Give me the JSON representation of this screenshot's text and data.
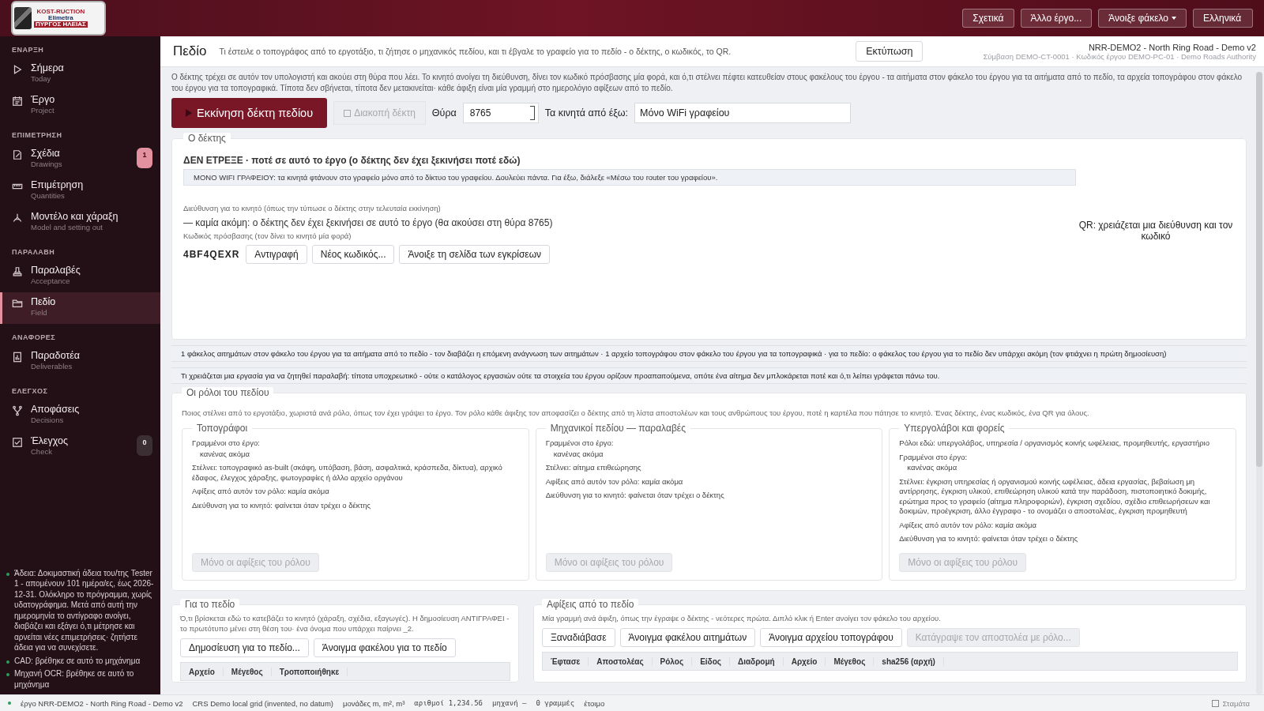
{
  "logo": {
    "lines": [
      "KOST-RUCTION",
      "Elimetra",
      "ΠΥΡΓΟΣ ΗΛΕΙΑΣ"
    ]
  },
  "header_buttons": [
    {
      "label": "Σχετικά",
      "has_menu": false
    },
    {
      "label": "Άλλο έργο...",
      "has_menu": false
    },
    {
      "label": "Άνοιξε φάκελο",
      "has_menu": true
    },
    {
      "label": "Ελληνικά",
      "has_menu": false
    }
  ],
  "sidebar": {
    "sections": [
      {
        "title": "ΕΝΑΡΞΗ",
        "items": [
          {
            "label": "Σήμερα",
            "sublabel": "Today",
            "selected": false
          },
          {
            "label": "Έργο",
            "sublabel": "Project",
            "selected": false
          }
        ]
      },
      {
        "title": "ΕΠΙΜΕΤΡΗΣΗ",
        "items": [
          {
            "label": "Σχέδια",
            "sublabel": "Drawings",
            "selected": false,
            "badge": "1",
            "color": "#e3909f"
          },
          {
            "label": "Επιμέτρηση",
            "sublabel": "Quantities",
            "selected": false
          },
          {
            "label": "Μοντέλο και χάραξη",
            "sublabel": "Model and setting out",
            "selected": false
          }
        ]
      },
      {
        "title": "ΠΑΡΑΛΑΒΗ",
        "items": [
          {
            "label": "Παραλαβές",
            "sublabel": "Acceptance",
            "selected": false
          },
          {
            "label": "Πεδίο",
            "sublabel": "Field",
            "selected": true
          }
        ]
      },
      {
        "title": "ΑΝΑΦΟΡΕΣ",
        "items": [
          {
            "label": "Παραδοτέα",
            "sublabel": "Deliverables",
            "selected": false
          }
        ]
      },
      {
        "title": "ΕΛΕΓΧΟΣ",
        "items": [
          {
            "label": "Αποφάσεις",
            "sublabel": "Decisions",
            "selected": false
          },
          {
            "label": "Έλεγχος",
            "sublabel": "Check",
            "selected": false,
            "badge": "0",
            "color": "#3b2f34"
          }
        ]
      }
    ],
    "notes": [
      {
        "text": "Άδεια: Δοκιμαστική άδεια του/της Tester 1 - απομένουν 101 ημέρα/ες, έως 2026-12-31. Ολόκληρο το πρόγραμμα, χωρίς υδατογράφημα. Μετά από αυτή την ημερομηνία το αντίγραφο ανοίγει, διαβάζει και εξάγει ό,τι μέτρησε και αρνείται νέες επιμετρήσεις· ζητήστε άδεια για να συνεχίσετε.",
        "color": "#2e9e5b"
      },
      {
        "text": "CAD: βρέθηκε σε αυτό το μηχάνημα",
        "color": "#2e9e5b"
      },
      {
        "text": "Μηχανή OCR: βρέθηκε σε αυτό το μηχάνημα",
        "color": "#2e9e5b"
      }
    ]
  },
  "page_header": {
    "title": "Πεδίο",
    "subtitle": "Τι έστειλε ο τοπογράφος από το εργοτάξιο, τι ζήτησε ο μηχανικός πεδίου, και τι έβγαλε το γραφείο για το πεδίο - ο δέκτης, ο κωδικός, το QR.",
    "print_button": "Εκτύπωση",
    "project": "NRR-DEMO2 - North Ring Road - Demo v2",
    "project_meta": "Σύμβαση DEMO-CT-0001 · Κωδικός έργου DEMO-PC-01 · Demo Roads Authority"
  },
  "intro": "Ο δέκτης τρέχει σε αυτόν τον υπολογιστή και ακούει στη θύρα που λέει. Το κινητό ανοίγει τη διεύθυνση, δίνει τον κωδικό πρόσβασης μία φορά, και ό,τι στέλνει πέφτει κατευθείαν στους φακέλους του έργου - τα αιτήματα στον φάκελο του έργου για τα αιτήματα από το πεδίο, τα αρχεία τοπογράφου στον φάκελο του έργου για τα τοπογραφικά. Τίποτα δεν σβήνεται, τίποτα δεν μετακινείται· κάθε άφιξη είναι μία γραμμή στο ημερολόγιο αφίξεων από το πεδίο.",
  "controls": {
    "start_button": {
      "label": "Εκκίνηση δέκτη πεδίου",
      "disabled": false
    },
    "stop_button": {
      "label": "Διακοπή δέκτη",
      "disabled": true
    },
    "port_label": "Θύρα",
    "port_value": "8765",
    "remote_label": "Τα κινητά από έξω:",
    "remote_value": "Μόνο WiFi γραφείου"
  },
  "receiver": {
    "legend": "Ο δέκτης",
    "status": "ΔΕΝ ΕΤΡΕΞΕ · ποτέ σε αυτό το έργο (ο δέκτης δεν έχει ξεκινήσει ποτέ εδώ)",
    "banner": "ΜΟΝΟ WIFI ΓΡΑΦΕΙΟΥ: τα κινητά φτάνουν στο γραφείο μόνο από το δίκτυο του γραφείου. Δουλεύει πάντα. Για έξω, διάλεξε «Μέσω του router του γραφείου».",
    "address_label": "Διεύθυνση για το κινητό (όπως την τύπωσε ο δέκτης στην τελευταία εκκίνηση)",
    "address": "— καμία ακόμη: ο δέκτης δεν έχει ξεκινήσει σε αυτό το έργο (θα ακούσει στη θύρα 8765)",
    "code_label": "Κωδικός πρόσβασης (τον δίνει το κινητό μία φορά)",
    "code": "4BF4QEXR",
    "buttons": [
      "Αντιγραφή",
      "Νέος κωδικός...",
      "Άνοιξε τη σελίδα των εγκρίσεων"
    ],
    "qr_note": "QR: χρειάζεται μια διεύθυνση και τον κωδικό"
  },
  "info_lines": [
    "1 φάκελος αιτημάτων στον φάκελο του έργου για τα αιτήματα από το πεδίο - τον διαβάζει η επόμενη ανάγνωση των αιτημάτων  ·  1 αρχείο τοπογράφου στον φάκελο του έργου για τα τοπογραφικά  ·  για το πεδίο: ο φάκελος του έργου για το πεδίο δεν υπάρχει ακόμη (τον φτιάχνει η πρώτη δημοσίευση)",
    "Τι χρειάζεται μια εργασία για να ζητηθεί παραλαβή: τίποτα υποχρεωτικό - ούτε ο κατάλογος εργασιών ούτε τα στοιχεία του έργου ορίζουν προαπαιτούμενα, οπότε ένα αίτημα δεν μπλοκάρεται ποτέ και ό,τι λείπει γράφεται πάνω του."
  ],
  "roles": {
    "legend": "Οι ρόλοι του πεδίου",
    "intro": "Ποιος στέλνει από το εργοτάξιο, χωριστά ανά ρόλο, όπως τον έχει γράψει το έργο. Τον ρόλο κάθε άφιξης τον αποφασίζει ο δέκτης από τη λίστα αποστολέων και τους ανθρώπους του έργου, ποτέ η καρτέλα που πάτησε το κινητό. Ένας δέκτης, ένας κωδικός, ένα QR για όλους.",
    "items": [
      {
        "title": "Τοπογράφοι",
        "lines": [
          {
            "text": "Γραμμένοι στο έργο:",
            "indented": false
          },
          {
            "text": "κανένας ακόμα",
            "indented": true
          },
          {
            "text": "Στέλνει: τοπογραφικό as-built (σκάφη, υπόβαση, βάση, ασφαλτικά, κράσπεδα, δίκτυα), αρχικό έδαφος, έλεγχος χάραξης, φωτογραφίες ή άλλο αρχείο οργάνου",
            "indented": false
          },
          {
            "text": "Αφίξεις από αυτόν τον ρόλο: καμία ακόμα",
            "indented": false
          },
          {
            "text": "Διεύθυνση για το κινητό: φαίνεται όταν τρέχει ο δέκτης",
            "indented": false
          }
        ],
        "button": {
          "label": "Μόνο οι αφίξεις του ρόλου",
          "disabled": true
        }
      },
      {
        "title": "Μηχανικοί πεδίου — παραλαβές",
        "lines": [
          {
            "text": "Γραμμένοι στο έργο:",
            "indented": false
          },
          {
            "text": "κανένας ακόμα",
            "indented": true
          },
          {
            "text": "Στέλνει: αίτημα επιθεώρησης",
            "indented": false
          },
          {
            "text": "Αφίξεις από αυτόν τον ρόλο: καμία ακόμα",
            "indented": false
          },
          {
            "text": "Διεύθυνση για το κινητό: φαίνεται όταν τρέχει ο δέκτης",
            "indented": false
          }
        ],
        "button": {
          "label": "Μόνο οι αφίξεις του ρόλου",
          "disabled": true
        }
      },
      {
        "title": "Υπεργολάβοι και φορείς",
        "lines": [
          {
            "text": "Ρόλοι εδώ: υπεργολάβος, υπηρεσία / οργανισμός κοινής ωφέλειας, προμηθευτής, εργαστήριο",
            "indented": false
          },
          {
            "text": "Γραμμένοι στο έργο:",
            "indented": false
          },
          {
            "text": "κανένας ακόμα",
            "indented": true
          },
          {
            "text": "Στέλνει: έγκριση υπηρεσίας ή οργανισμού κοινής ωφέλειας, άδεια εργασίας, βεβαίωση μη αντίρρησης, έγκριση υλικού, επιθεώρηση υλικού κατά την παράδοση, πιστοποιητικό δοκιμής, ερώτημα προς το γραφείο (αίτημα πληροφοριών), έγκριση σχεδίου, σχέδιο επιθεωρήσεων και δοκιμών, προέγκριση, άλλο έγγραφο - το ονομάζει ο αποστολέας, έγκριση προμηθευτή",
            "indented": false
          },
          {
            "text": "Αφίξεις από αυτόν τον ρόλο: καμία ακόμα",
            "indented": false
          },
          {
            "text": "Διεύθυνση για το κινητό: φαίνεται όταν τρέχει ο δέκτης",
            "indented": false
          }
        ],
        "button": {
          "label": "Μόνο οι αφίξεις του ρόλου",
          "disabled": true
        }
      }
    ]
  },
  "for_field": {
    "legend": "Για το πεδίο",
    "text": "Ό,τι βρίσκεται εδώ το κατεβάζει το κινητό (χάραξη, σχέδια, εξαγωγές). Η δημοσίευση ΑΝΤΙΓΡΑΦΕΙ - το πρωτότυπο μένει στη θέση του· ένα όνομα που υπάρχει παίρνει _2.",
    "buttons": [
      {
        "label": "Δημοσίευση για το πεδίο...",
        "disabled": false
      },
      {
        "label": "Άνοιγμα φακέλου για το πεδίο",
        "disabled": false
      }
    ],
    "columns": [
      "Αρχείο",
      "Μέγεθος",
      "Τροποποιήθηκε"
    ]
  },
  "arrivals": {
    "legend": "Αφίξεις από το πεδίο",
    "text": "Μία γραμμή ανά άφιξη, όπως την έγραψε ο δέκτης - νεότερες πρώτα. Διπλό κλικ ή Enter ανοίγει τον φάκελο του αρχείου.",
    "buttons": [
      {
        "label": "Ξαναδιάβασε",
        "disabled": false
      },
      {
        "label": "Άνοιγμα φακέλου αιτημάτων",
        "disabled": false
      },
      {
        "label": "Άνοιγμα αρχείου τοπογράφου",
        "disabled": false
      },
      {
        "label": "Κατάγραψε τον αποστολέα με ρόλο...",
        "disabled": true
      }
    ],
    "columns": [
      "Έφτασε",
      "Αποστολέας",
      "Ρόλος",
      "Είδος",
      "Διαδρομή",
      "Αρχείο",
      "Μέγεθος",
      "sha256 (αρχή)"
    ]
  },
  "status_bar": {
    "items": [
      {
        "text": "έργο NRR-DEMO2 - North Ring Road - Demo v2",
        "mono": false
      },
      {
        "text": "CRS Demo local grid (invented, no datum)",
        "mono": false
      },
      {
        "text": "μονάδες m, m², m³",
        "mono": false
      },
      {
        "text": "αριθμοί 1,234.56",
        "mono": true
      },
      {
        "text": "μηχανή —",
        "mono": true
      },
      {
        "text": "0 γραμμές",
        "mono": true
      },
      {
        "text": "έτοιμο",
        "mono": false
      }
    ],
    "stop": {
      "label": "Σταμάτα",
      "checked": false
    }
  }
}
